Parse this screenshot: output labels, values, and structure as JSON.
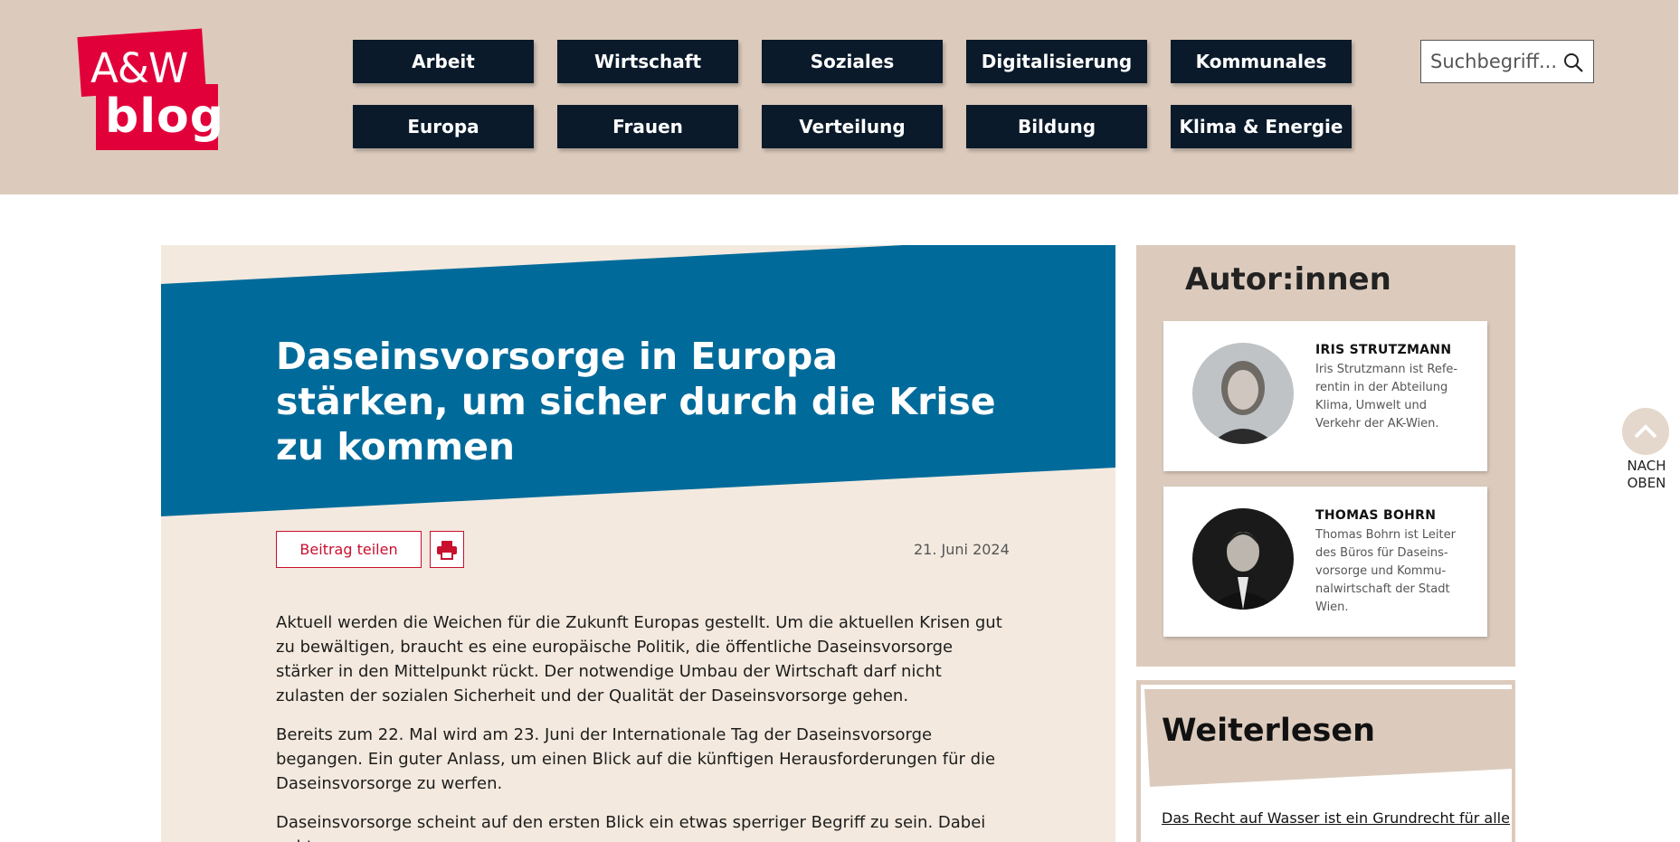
{
  "logo": {
    "top": "A&W",
    "bottom": "blog"
  },
  "nav": {
    "row1": [
      "Arbeit",
      "Wirtschaft",
      "Soziales",
      "Digitalisierung",
      "Kommunales"
    ],
    "row2": [
      "Europa",
      "Frauen",
      "Verteilung",
      "Bildung",
      "Klima & Energie"
    ]
  },
  "search": {
    "placeholder": "Suchbegriff...",
    "icon": "search-icon"
  },
  "article": {
    "title": "Daseinsvorsorge in Europa stärken, um sicher durch die Krise zu kommen",
    "share_label": "Beitrag teilen",
    "print_icon": "printer-icon",
    "date": "21. Juni 2024",
    "paragraphs": [
      "Aktuell werden die Weichen für die Zukunft Europas gestellt. Um die aktuellen Krisen gut zu bewältigen, braucht es eine europäische Politik, die öffentliche Daseinsvorsorge stärker in den Mittelpunkt rückt. Der notwendige Umbau der Wirtschaft darf nicht zulasten der sozialen Sicherheit und der Qualität der Daseinsvorsorge gehen.",
      "Bereits zum 22. Mal wird am 23. Juni der Internationale Tag der Daseinsvorsorge begangen. Ein guter Anlass, um einen Blick auf die künftigen Herausforderungen für die Daseinsvorsorge zu werfen.",
      "Daseinsvorsorge scheint auf den ersten Blick ein etwas sperriger Begriff zu sein. Dabei geht es"
    ],
    "colors": {
      "banner": "#006b9a",
      "accent": "#c8102e"
    }
  },
  "authors": {
    "heading": "Autor:innen",
    "items": [
      {
        "name": "IRIS STRUTZMANN",
        "bio": "Iris Strutzmann ist Refe-rentin in der Abteilung Klima, Umwelt und Verkehr der AK-Wien."
      },
      {
        "name": "THOMAS BOHRN",
        "bio": "Thomas Bohrn ist Leiter des Büros für Daseins-vorsorge und Kommu-nalwirtschaft der Stadt Wien."
      }
    ]
  },
  "weiterlesen": {
    "heading": "Weiterlesen",
    "link": "Das Recht auf Wasser ist ein Grundrecht für alle"
  },
  "back_to_top": {
    "line1": "NACH",
    "line2": "OBEN",
    "icon": "chevron-up-icon"
  }
}
